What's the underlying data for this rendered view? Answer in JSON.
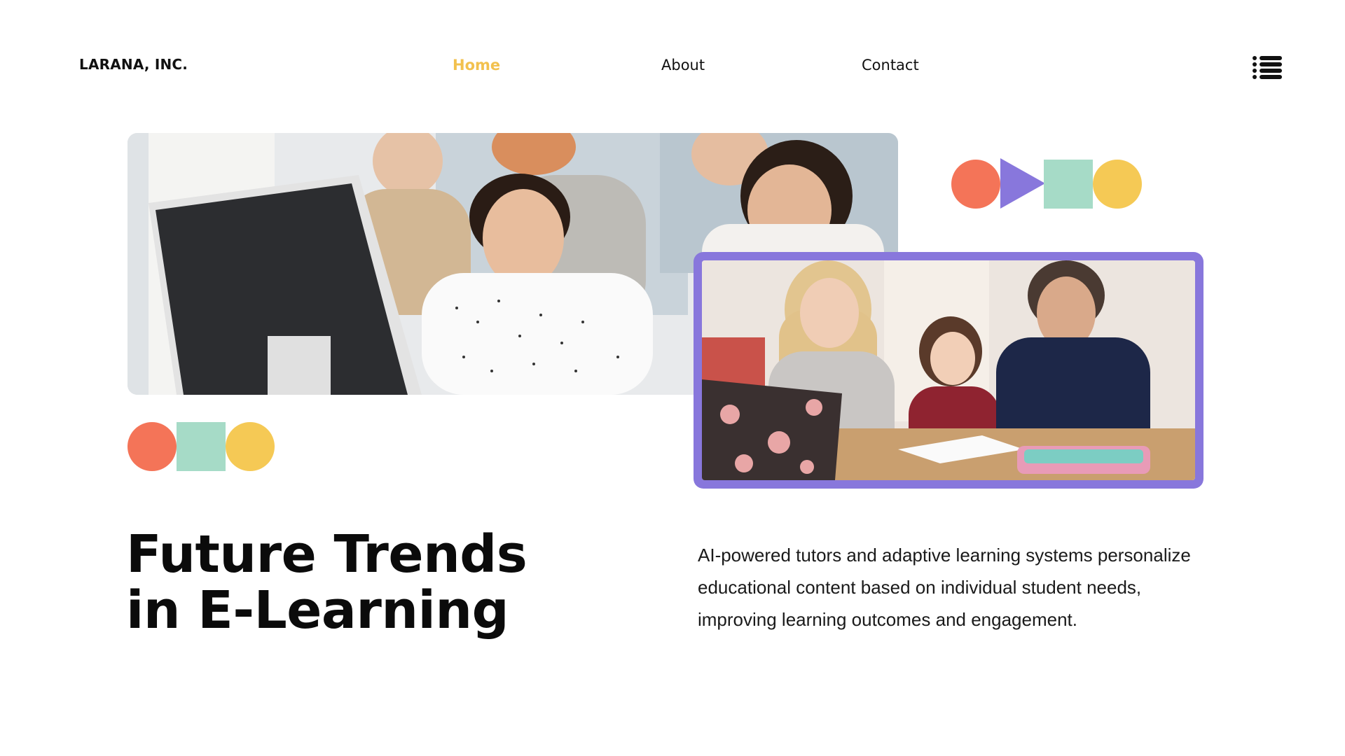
{
  "header": {
    "brand": "LARANA, INC.",
    "nav": [
      {
        "label": "Home",
        "active": true
      },
      {
        "label": "About",
        "active": false
      },
      {
        "label": "Contact",
        "active": false
      }
    ],
    "menu_icon": "list-icon"
  },
  "hero": {
    "title_line1": "Future Trends",
    "title_line2": "in E-Learning",
    "description": "AI-powered tutors and adaptive learning systems personalize educational content based on individual student needs, improving learning outcomes and engagement."
  },
  "images": {
    "main": "office-team-computer-photo",
    "secondary": "family-learning-laptop-photo"
  },
  "colors": {
    "accent": "#f2c14e",
    "coral": "#f47458",
    "purple": "#8877dc",
    "mint": "#a6dbc7",
    "yellow": "#f5c955",
    "text": "#111111",
    "background": "#ffffff"
  }
}
